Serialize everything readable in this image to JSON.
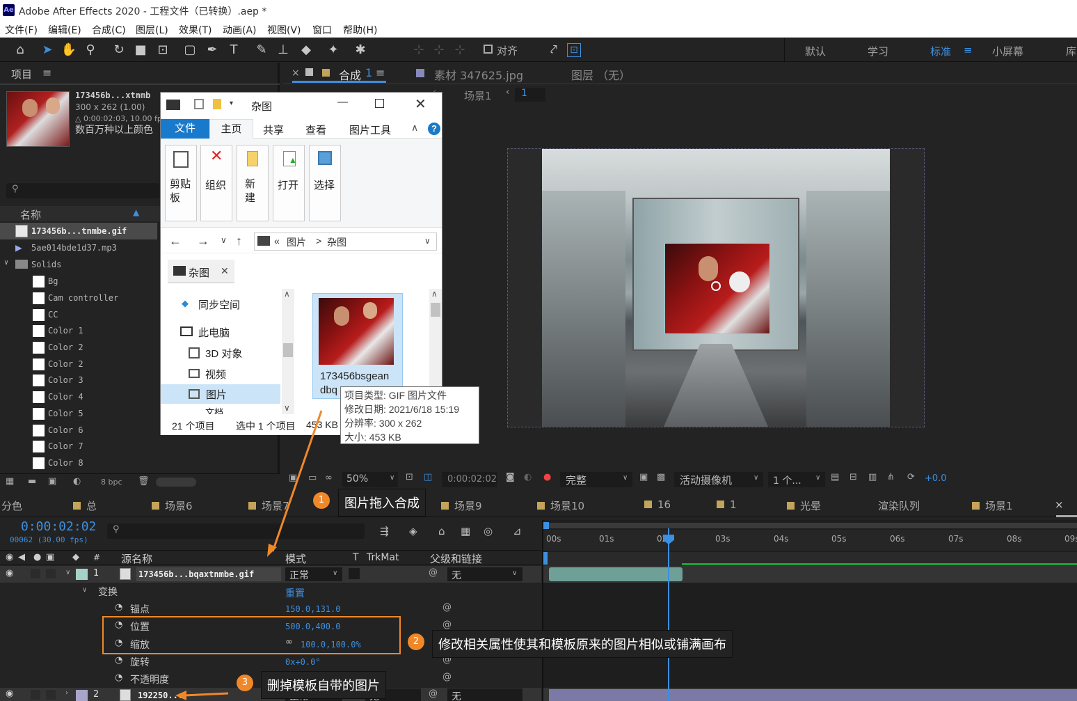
{
  "titlebar": {
    "icon": "Ae",
    "title": "Adobe After Effects 2020 - 工程文件（已转换）.aep *"
  },
  "menu": [
    "文件(F)",
    "编辑(E)",
    "合成(C)",
    "图层(L)",
    "效果(T)",
    "动画(A)",
    "视图(V)",
    "窗口",
    "帮助(H)"
  ],
  "toolbar": {
    "align_label": "对齐",
    "workspaces": [
      "默认",
      "学习",
      "标准",
      "小屏幕",
      "库"
    ],
    "active_workspace": "标准",
    "workspace_menu_icon": "≡"
  },
  "project": {
    "title": "项目",
    "menu_icon": "≡",
    "preview": {
      "name": "173456b...xtnmb",
      "dims": "300 x 262 (1.00)",
      "duration": "△ 0:00:02:03, 10.00 fp",
      "desc": "数百万种以上颜色"
    },
    "col_name": "名称",
    "items": [
      {
        "label": "173456b...tnmbe.gif",
        "selected": true
      },
      {
        "label": "5ae014bde1d37.mp3"
      },
      {
        "label": "Solids"
      },
      {
        "label": "Bg"
      },
      {
        "label": "Cam controller"
      },
      {
        "label": "CC"
      },
      {
        "label": "Color 1"
      },
      {
        "label": "Color 2"
      },
      {
        "label": "Color 2"
      },
      {
        "label": "Color 3"
      },
      {
        "label": "Color 4"
      },
      {
        "label": "Color 5"
      },
      {
        "label": "Color 6"
      },
      {
        "label": "Color 7"
      },
      {
        "label": "Color 8"
      }
    ],
    "bpc": "8 bpc"
  },
  "explorer": {
    "title": "杂图",
    "ribbon_tabs": [
      "文件",
      "主页",
      "共享",
      "查看",
      "图片工具"
    ],
    "ribbon_groups": [
      "剪贴板",
      "组织",
      "新建",
      "打开",
      "选择"
    ],
    "path": [
      "«",
      "图片",
      ">",
      "杂图"
    ],
    "tab_label": "杂图",
    "nav": [
      "同步空间",
      "此电脑",
      "3D 对象",
      "视频",
      "图片",
      "文档"
    ],
    "file_name": "173456bsgeandbq...",
    "file_line1": "173456bsgean",
    "file_line2": "dbq",
    "status": [
      "21 个项目",
      "选中 1 个项目",
      "453 KB"
    ]
  },
  "tooltip": {
    "lines": [
      "项目类型: GIF 图片文件",
      "修改日期: 2021/6/18 15:19",
      "分辨率: 300 x 262",
      "大小: 453 KB"
    ]
  },
  "viewer": {
    "comp_tab": "合成",
    "comp_num": "1",
    "footage_tab": "素材 347625.jpg",
    "layer_tab": "图层 （无）",
    "breadcrumb": "场景1",
    "breadcrumb_num": "1",
    "zoom": "50%",
    "timecode": "0:00:02:02",
    "quality": "完整",
    "camera": "活动摄像机",
    "views": "1 个...",
    "exposure": "+0.0"
  },
  "timeline": {
    "tabs": [
      "分色",
      "总",
      "场景6",
      "场景7",
      "场景9",
      "场景10",
      "16",
      "1",
      "光晕",
      "渲染队列",
      "场景1"
    ],
    "timecode": "0:00:02:02",
    "frames": "00062 (30.00 fps)",
    "col_source": "源名称",
    "col_mode": "模式",
    "col_t": "T",
    "col_trkmat": "TrkMat",
    "col_parent": "父级和链接",
    "ruler": [
      "00s",
      "01s",
      "02s",
      "03s",
      "04s",
      "05s",
      "06s",
      "07s",
      "08s",
      "09s"
    ],
    "layer1": {
      "num": "1",
      "name": "173456b...bqaxtnmbe.gif",
      "mode": "正常",
      "parent": "无"
    },
    "transform": {
      "label": "变换",
      "reset": "重置"
    },
    "props": [
      {
        "name": "锚点",
        "value": "150.0,131.0"
      },
      {
        "name": "位置",
        "value": "500.0,400.0"
      },
      {
        "name": "缩放",
        "value": "100.0,100.0%"
      },
      {
        "name": "旋转",
        "value": "0x+0.0°"
      },
      {
        "name": "不透明度",
        "value": ""
      }
    ],
    "layer2": {
      "num": "2",
      "name": "192250...",
      "mode": "正常",
      "trkmat": "无",
      "parent": "无"
    }
  },
  "callouts": [
    {
      "num": "1",
      "text": "图片拖入合成"
    },
    {
      "num": "2",
      "text": "修改相关属性使其和模板原来的图片相似或铺满画布"
    },
    {
      "num": "3",
      "text": "删掉模板自带的图片"
    }
  ],
  "colors": {
    "accent_blue": "#3d8fe0",
    "callout_orange": "#f0882a",
    "label_yellow": "#c4a45a",
    "ribbon_blue": "#1979ca"
  }
}
